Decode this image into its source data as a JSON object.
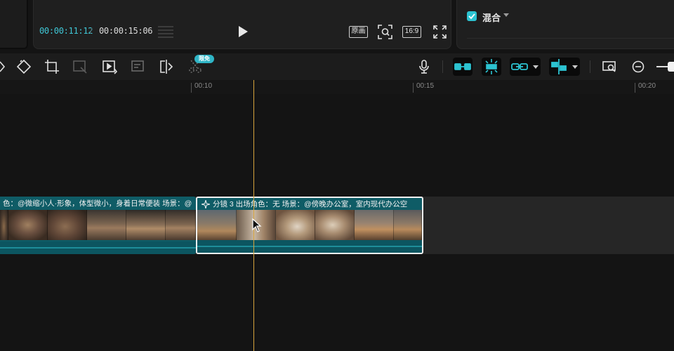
{
  "player": {
    "current_time": "00:00:11:12",
    "separator": "/",
    "total_time": "00:00:15:06",
    "original_label": "原画",
    "ratio_label": "16:9"
  },
  "properties": {
    "mix_label": "混合",
    "mix_checked": true
  },
  "toolbar": {
    "free_badge": "限免",
    "accent_color": "#2cc3d1"
  },
  "ruler": {
    "labels": [
      "00:10",
      "00:15",
      "00:20"
    ]
  },
  "timeline": {
    "clips": [
      {
        "title": "色：@微缩小人·形象，体型微小，身着日常便装 场景：@"
      },
      {
        "title": "分镜 3 出场角色：无 场景：@傍晚办公室，室内现代办公空"
      }
    ]
  }
}
